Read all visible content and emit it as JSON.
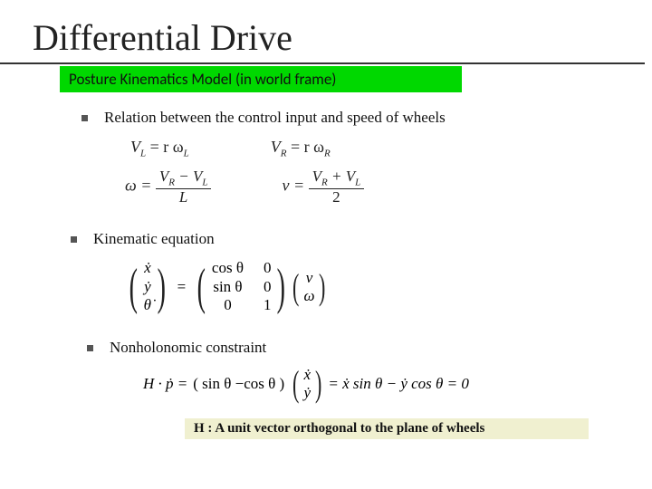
{
  "title": "Differential Drive",
  "subtitle": "Posture Kinematics Model (in world frame)",
  "bullets": {
    "b1": "Relation between the control input and speed of wheels",
    "b2": "Kinematic equation",
    "b3": "Nonholonomic  constraint"
  },
  "eqs": {
    "vl": {
      "lhs": "V",
      "lsub": "L",
      "rhs": "= r ω",
      "rsub": "L"
    },
    "vr": {
      "lhs": "V",
      "lsub": "R",
      "rhs": "= r ω",
      "rsub": "R"
    },
    "omega": {
      "lhs": "ω =",
      "num_a": "V",
      "num_asub": "R",
      "num_mid": " − V",
      "num_bsub": "L",
      "den": "L"
    },
    "v": {
      "lhs": "v =",
      "num_a": "V",
      "num_asub": "R",
      "num_mid": " + V",
      "num_bsub": "L",
      "den": "2"
    }
  },
  "kinematic": {
    "state": [
      "ẋ",
      "ẏ",
      "θ̇"
    ],
    "eq": "=",
    "col1": [
      "cos θ",
      "sin θ",
      "0"
    ],
    "col2": [
      "0",
      "0",
      "1"
    ],
    "input": [
      "v",
      "ω"
    ]
  },
  "nonholo": {
    "lhs": "H · ṗ =",
    "row": "( sin θ   −cos θ )",
    "vec": [
      "ẋ",
      "ẏ"
    ],
    "rhs": "= ẋ sin θ − ẏ cos θ = 0"
  },
  "footer": "H : A unit vector orthogonal to the plane of wheels"
}
